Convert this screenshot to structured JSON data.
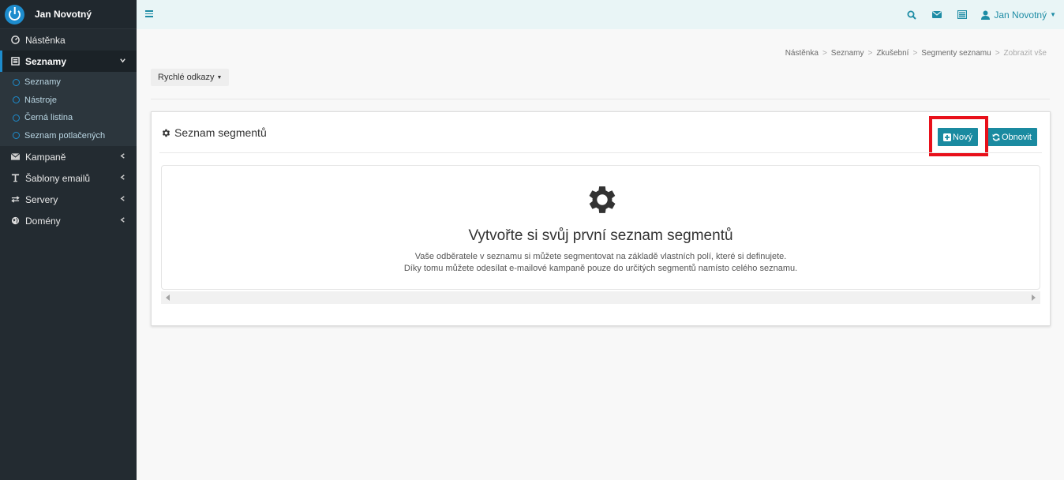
{
  "brand": {
    "name": "Jan Novotný"
  },
  "sidebar": {
    "items": [
      {
        "label": "Nástěnka",
        "icon": "dashboard-icon"
      },
      {
        "label": "Seznamy",
        "icon": "list-icon",
        "active": true
      },
      {
        "label": "Kampaně",
        "icon": "envelope-icon"
      },
      {
        "label": "Šablony emailů",
        "icon": "text-icon"
      },
      {
        "label": "Servery",
        "icon": "transfer-icon"
      },
      {
        "label": "Domény",
        "icon": "globe-icon"
      }
    ],
    "submenu": [
      {
        "label": "Seznamy"
      },
      {
        "label": "Nástroje"
      },
      {
        "label": "Černá listina"
      },
      {
        "label": "Seznam potlačených"
      }
    ]
  },
  "topbar": {
    "user_name": "Jan Novotný"
  },
  "breadcrumb": [
    "Nástěnka",
    "Seznamy",
    "Zkušební",
    "Segmenty seznamu",
    "Zobrazit vše"
  ],
  "quick_links": {
    "label": "Rychlé odkazy"
  },
  "panel": {
    "title": "Seznam segmentů",
    "new_button": "Nový",
    "refresh_button": "Obnovit",
    "empty": {
      "title": "Vytvořte si svůj první seznam segmentů",
      "line1": "Vaše odběratele v seznamu si můžete segmentovat na základě vlastních polí, které si definujete.",
      "line2": "Díky tomu můžete odesílat e-mailové kampaně pouze do určitých segmentů namísto celého seznamu."
    }
  },
  "colors": {
    "accent": "#1a8aa0",
    "highlight": "#e8101a",
    "sidebar": "#232b31"
  }
}
